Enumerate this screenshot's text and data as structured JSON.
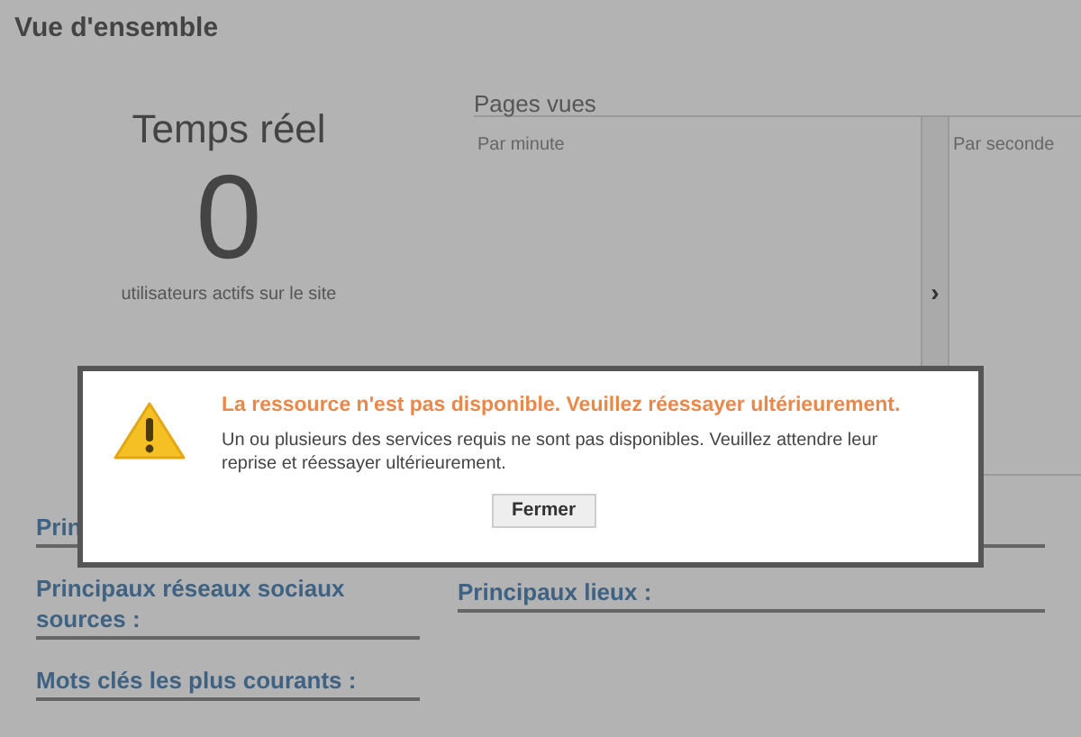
{
  "page": {
    "title": "Vue d'ensemble"
  },
  "realtime": {
    "title": "Temps réel",
    "count": "0",
    "caption": "utilisateurs actifs sur le site"
  },
  "pageviews": {
    "title": "Pages vues",
    "panels": [
      {
        "label": "Par minute"
      },
      {
        "label": "Par seconde"
      }
    ],
    "toggle": "›"
  },
  "sections_left": [
    {
      "title": "Prin"
    },
    {
      "title": "Principaux réseaux sociaux sources :"
    },
    {
      "title": "Mots clés les plus courants :"
    }
  ],
  "sections_right": [
    {
      "title": "Principaux lieux :"
    }
  ],
  "dialog": {
    "title": "La ressource n'est pas disponible. Veuillez réessayer ultérieurement.",
    "message": "Un ou plusieurs des services requis ne sont pas disponibles. Veuillez attendre leur reprise et réessayer ultérieurement.",
    "buttons": [
      "Fermer"
    ]
  }
}
